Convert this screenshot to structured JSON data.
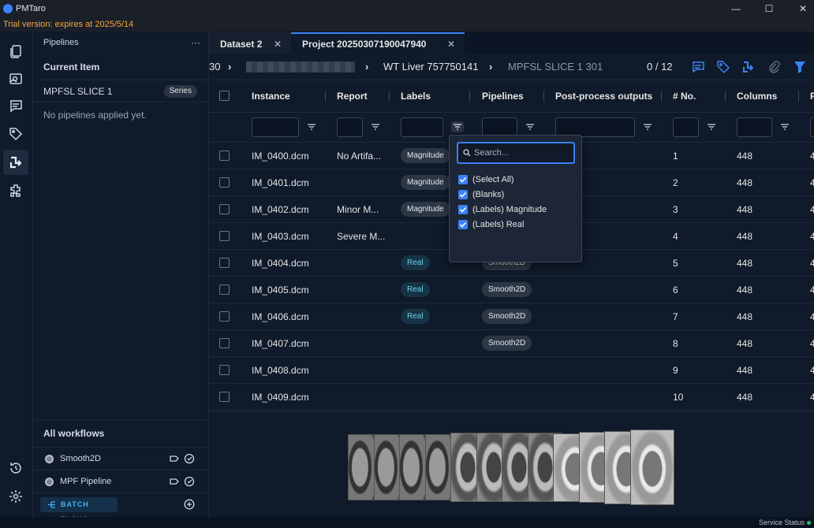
{
  "window": {
    "app_title": "PMTaro",
    "minimize": "—",
    "maximize": "☐",
    "close": "✕"
  },
  "trial": {
    "text": "Trial version: expires at 2025/5/14"
  },
  "rail": {
    "icons": [
      "documents-icon",
      "image-viewer-icon",
      "comments-icon",
      "tags-icon",
      "pipelines-icon",
      "plugins-icon",
      "history-icon",
      "settings-icon"
    ],
    "active": "pipelines-icon"
  },
  "left_panel": {
    "header": "Pipelines",
    "more": "···",
    "current_item_label": "Current Item",
    "item_name": "MPFSL SLICE 1",
    "item_badge": "Series",
    "empty_text": "No pipelines applied yet.",
    "workflows_title": "All workflows",
    "workflows": [
      {
        "name": "Smooth2D"
      },
      {
        "name": "MPF Pipeline"
      }
    ],
    "batch_label": "BATCH TASKS"
  },
  "tabs": [
    {
      "label": "Dataset 2",
      "active": false
    },
    {
      "label": "Project 20250307190047940",
      "active": true
    }
  ],
  "breadcrumb": {
    "partial": "30",
    "item2": "WT Liver 757750141",
    "item3": "MPFSL SLICE 1 301",
    "counter": "0 / 12"
  },
  "colors": {
    "accent": "#3b82f6",
    "real_chip_text": "#6ad0e8",
    "trial_text": "#f2a93b",
    "status_ok": "#22c55e"
  },
  "grid": {
    "columns": [
      "Instance",
      "Report",
      "Labels",
      "Pipelines",
      "Post-process outputs",
      "# No.",
      "Columns",
      "R"
    ],
    "rows": [
      {
        "instance": "IM_0400.dcm",
        "report": "No Artifa...",
        "label": "Magnitude",
        "pipeline": "",
        "no": "1",
        "columns": "448",
        "r": "4"
      },
      {
        "instance": "IM_0401.dcm",
        "report": "",
        "label": "Magnitude",
        "pipeline": "",
        "no": "2",
        "columns": "448",
        "r": "4"
      },
      {
        "instance": "IM_0402.dcm",
        "report": "Minor M...",
        "label": "Magnitude",
        "pipeline": "",
        "no": "3",
        "columns": "448",
        "r": "4"
      },
      {
        "instance": "IM_0403.dcm",
        "report": "Severe M...",
        "label": "",
        "pipeline": "",
        "no": "4",
        "columns": "448",
        "r": "4"
      },
      {
        "instance": "IM_0404.dcm",
        "report": "",
        "label": "Real",
        "pipeline": "Smooth2D",
        "no": "5",
        "columns": "448",
        "r": "4"
      },
      {
        "instance": "IM_0405.dcm",
        "report": "",
        "label": "Real",
        "pipeline": "Smooth2D",
        "no": "6",
        "columns": "448",
        "r": "4"
      },
      {
        "instance": "IM_0406.dcm",
        "report": "",
        "label": "Real",
        "pipeline": "Smooth2D",
        "no": "7",
        "columns": "448",
        "r": "4"
      },
      {
        "instance": "IM_0407.dcm",
        "report": "",
        "label": "",
        "pipeline": "Smooth2D",
        "no": "8",
        "columns": "448",
        "r": "4"
      },
      {
        "instance": "IM_0408.dcm",
        "report": "",
        "label": "",
        "pipeline": "",
        "no": "9",
        "columns": "448",
        "r": "4"
      },
      {
        "instance": "IM_0409.dcm",
        "report": "",
        "label": "",
        "pipeline": "",
        "no": "10",
        "columns": "448",
        "r": "4"
      }
    ]
  },
  "filter_popup": {
    "search_placeholder": "Search...",
    "options": [
      {
        "label": "(Select All)",
        "checked": true
      },
      {
        "label": "(Blanks)",
        "checked": true
      },
      {
        "label": "(Labels) Magnitude",
        "checked": true
      },
      {
        "label": "(Labels) Real",
        "checked": true
      }
    ]
  },
  "status": {
    "text": "Service Status"
  }
}
